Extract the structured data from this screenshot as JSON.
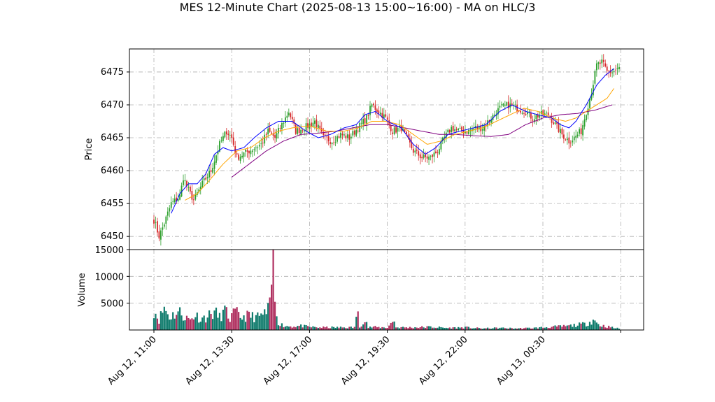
{
  "title": "MES 12-Minute Chart (2025-08-13 15:00~16:00) - MA on HLC/3",
  "colors": {
    "up": "#2ca02c",
    "down": "#d62728",
    "ma_fast": "#0000ff",
    "ma_mid": "#ffa500",
    "ma_slow": "#800080",
    "vol_up": "#0f7b6c",
    "vol_down": "#b03060",
    "grid": "#b0b0b0"
  },
  "chart_data": [
    {
      "type": "candlestick",
      "title": "MES 12-Minute Chart (2025-08-13 15:00~16:00) - MA on HLC/3",
      "ylabel": "Price",
      "ylim": [
        6448,
        6478.5
      ],
      "yticks": [
        6450,
        6455,
        6460,
        6465,
        6470,
        6475
      ],
      "xtick_labels": [
        "Aug 12, 11:00",
        "Aug 12, 13:30",
        "Aug 12, 17:00",
        "Aug 12, 19:30",
        "Aug 12, 22:00",
        "Aug 13, 00:30"
      ],
      "grid": true,
      "close_anchors": [
        [
          0,
          6452.5
        ],
        [
          3,
          6450
        ],
        [
          6,
          6452
        ],
        [
          10,
          6455
        ],
        [
          15,
          6456
        ],
        [
          17,
          6459
        ],
        [
          20,
          6457
        ],
        [
          23,
          6455.5
        ],
        [
          28,
          6458
        ],
        [
          33,
          6460
        ],
        [
          38,
          6464
        ],
        [
          42,
          6466
        ],
        [
          45,
          6465
        ],
        [
          48,
          6462
        ],
        [
          55,
          6463
        ],
        [
          62,
          6464
        ],
        [
          66,
          6466
        ],
        [
          70,
          6465
        ],
        [
          74,
          6467
        ],
        [
          78,
          6469
        ],
        [
          82,
          6466
        ],
        [
          87,
          6466.5
        ],
        [
          93,
          6467.5
        ],
        [
          98,
          6465
        ],
        [
          103,
          6464.5
        ],
        [
          108,
          6465.5
        ],
        [
          113,
          6465
        ],
        [
          118,
          6466.5
        ],
        [
          123,
          6468
        ],
        [
          126,
          6470
        ],
        [
          130,
          6469
        ],
        [
          134,
          6468
        ],
        [
          138,
          6466
        ],
        [
          143,
          6466.5
        ],
        [
          146,
          6465
        ],
        [
          150,
          6463
        ],
        [
          155,
          6462
        ],
        [
          160,
          6462
        ],
        [
          164,
          6463
        ],
        [
          168,
          6465
        ],
        [
          172,
          6466.5
        ],
        [
          177,
          6466
        ],
        [
          182,
          6466
        ],
        [
          186,
          6466.5
        ],
        [
          190,
          6466.5
        ],
        [
          195,
          6468
        ],
        [
          200,
          6469.5
        ],
        [
          205,
          6470
        ],
        [
          210,
          6469.5
        ],
        [
          215,
          6469
        ],
        [
          219,
          6468
        ],
        [
          223,
          6468.5
        ],
        [
          228,
          6468.5
        ],
        [
          232,
          6467
        ],
        [
          236,
          6465.5
        ],
        [
          240,
          6464.5
        ],
        [
          243,
          6465
        ],
        [
          247,
          6466
        ],
        [
          250,
          6469
        ],
        [
          253,
          6472
        ],
        [
          256,
          6476
        ],
        [
          259,
          6476.5
        ],
        [
          262,
          6475
        ],
        [
          265,
          6475
        ],
        [
          268,
          6475.5
        ]
      ],
      "ma_fast_anchors": [
        [
          10,
          6453.5
        ],
        [
          15,
          6456.5
        ],
        [
          20,
          6458
        ],
        [
          25,
          6458
        ],
        [
          30,
          6459.5
        ],
        [
          35,
          6462.5
        ],
        [
          40,
          6463.5
        ],
        [
          45,
          6463
        ],
        [
          52,
          6463.5
        ],
        [
          58,
          6465
        ],
        [
          65,
          6466.5
        ],
        [
          72,
          6467.5
        ],
        [
          80,
          6467.5
        ],
        [
          88,
          6466
        ],
        [
          95,
          6465
        ],
        [
          102,
          6465.5
        ],
        [
          110,
          6466.5
        ],
        [
          117,
          6467
        ],
        [
          122,
          6468.5
        ],
        [
          128,
          6469
        ],
        [
          135,
          6467.5
        ],
        [
          143,
          6466.5
        ],
        [
          150,
          6464
        ],
        [
          157,
          6462.5
        ],
        [
          163,
          6463.5
        ],
        [
          170,
          6465.5
        ],
        [
          177,
          6466
        ],
        [
          185,
          6466.5
        ],
        [
          192,
          6467
        ],
        [
          200,
          6469
        ],
        [
          207,
          6470
        ],
        [
          215,
          6469
        ],
        [
          222,
          6468.5
        ],
        [
          230,
          6468
        ],
        [
          235,
          6467
        ],
        [
          240,
          6466.5
        ],
        [
          244,
          6467.5
        ],
        [
          250,
          6470
        ],
        [
          256,
          6473
        ],
        [
          261,
          6474.5
        ],
        [
          266,
          6475.5
        ]
      ],
      "ma_mid_anchors": [
        [
          18,
          6455.5
        ],
        [
          25,
          6456.5
        ],
        [
          32,
          6458.5
        ],
        [
          40,
          6461
        ],
        [
          48,
          6463
        ],
        [
          56,
          6463.5
        ],
        [
          64,
          6465
        ],
        [
          72,
          6466
        ],
        [
          80,
          6466.5
        ],
        [
          90,
          6466.8
        ],
        [
          100,
          6466
        ],
        [
          110,
          6466
        ],
        [
          118,
          6466.5
        ],
        [
          126,
          6467.5
        ],
        [
          134,
          6467.5
        ],
        [
          142,
          6467
        ],
        [
          150,
          6465.5
        ],
        [
          158,
          6464
        ],
        [
          166,
          6464.5
        ],
        [
          174,
          6465.5
        ],
        [
          182,
          6466
        ],
        [
          190,
          6466.5
        ],
        [
          198,
          6467.5
        ],
        [
          206,
          6468.5
        ],
        [
          214,
          6469.5
        ],
        [
          222,
          6469
        ],
        [
          230,
          6468
        ],
        [
          238,
          6467.5
        ],
        [
          244,
          6468
        ],
        [
          250,
          6469
        ],
        [
          256,
          6470
        ],
        [
          262,
          6471
        ],
        [
          266,
          6472.5
        ]
      ],
      "ma_slow_anchors": [
        [
          45,
          6459
        ],
        [
          55,
          6461
        ],
        [
          65,
          6463
        ],
        [
          75,
          6464.5
        ],
        [
          85,
          6465.5
        ],
        [
          95,
          6465.7
        ],
        [
          105,
          6466
        ],
        [
          115,
          6466.5
        ],
        [
          125,
          6467
        ],
        [
          135,
          6467
        ],
        [
          145,
          6466.5
        ],
        [
          155,
          6466
        ],
        [
          165,
          6465.5
        ],
        [
          175,
          6465.5
        ],
        [
          185,
          6465.3
        ],
        [
          195,
          6465.2
        ],
        [
          205,
          6465.5
        ],
        [
          215,
          6467
        ],
        [
          225,
          6468
        ],
        [
          235,
          6468.5
        ],
        [
          245,
          6468.7
        ],
        [
          255,
          6469.2
        ],
        [
          265,
          6470
        ]
      ],
      "n_bars": 270
    },
    {
      "type": "bar",
      "ylabel": "Volume",
      "ylim": [
        0,
        15000
      ],
      "yticks": [
        5000,
        10000,
        15000
      ],
      "grid": true,
      "volume_anchors": [
        [
          0,
          4000
        ],
        [
          3,
          2000
        ],
        [
          6,
          4500
        ],
        [
          9,
          2500
        ],
        [
          12,
          3200
        ],
        [
          15,
          3500
        ],
        [
          18,
          2500
        ],
        [
          21,
          2000
        ],
        [
          24,
          3000
        ],
        [
          27,
          2200
        ],
        [
          30,
          2500
        ],
        [
          35,
          3500
        ],
        [
          38,
          2500
        ],
        [
          41,
          3800
        ],
        [
          44,
          2200
        ],
        [
          47,
          3500
        ],
        [
          50,
          2500
        ],
        [
          55,
          2800
        ],
        [
          60,
          2500
        ],
        [
          65,
          3300
        ],
        [
          67,
          4500
        ],
        [
          68,
          9500
        ],
        [
          69,
          13700
        ],
        [
          70,
          5500
        ],
        [
          72,
          1500
        ],
        [
          75,
          800
        ],
        [
          80,
          700
        ],
        [
          85,
          800
        ],
        [
          90,
          600
        ],
        [
          95,
          500
        ],
        [
          100,
          500
        ],
        [
          110,
          500
        ],
        [
          116,
          500
        ],
        [
          117,
          3000
        ],
        [
          118,
          2800
        ],
        [
          119,
          500
        ],
        [
          122,
          2500
        ],
        [
          124,
          500
        ],
        [
          127,
          600
        ],
        [
          130,
          500
        ],
        [
          135,
          500
        ],
        [
          139,
          2000
        ],
        [
          140,
          500
        ],
        [
          150,
          500
        ],
        [
          160,
          600
        ],
        [
          170,
          400
        ],
        [
          180,
          500
        ],
        [
          190,
          300
        ],
        [
          200,
          400
        ],
        [
          210,
          300
        ],
        [
          220,
          400
        ],
        [
          230,
          600
        ],
        [
          235,
          700
        ],
        [
          240,
          800
        ],
        [
          245,
          1000
        ],
        [
          250,
          1200
        ],
        [
          254,
          2000
        ],
        [
          258,
          900
        ],
        [
          262,
          700
        ],
        [
          266,
          400
        ],
        [
          269,
          300
        ]
      ]
    }
  ]
}
